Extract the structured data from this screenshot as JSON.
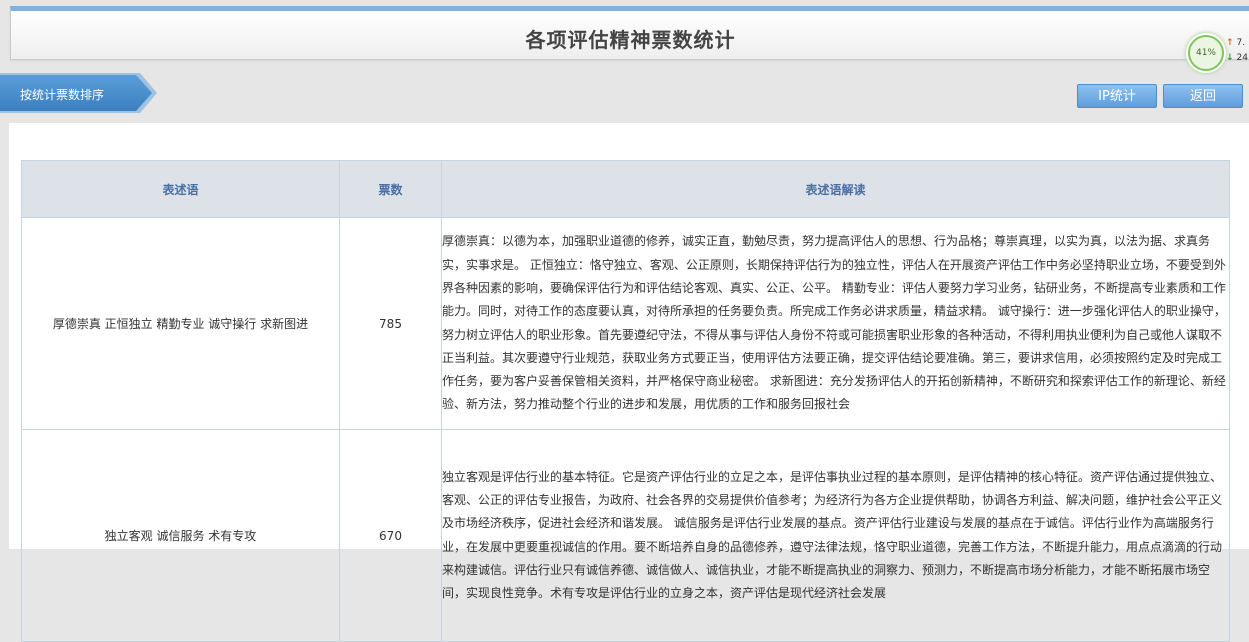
{
  "header": {
    "title": "各项评估精神票数统计"
  },
  "gauge": {
    "percent": "41%",
    "up_value": "7.",
    "down_value": "24"
  },
  "toolbar": {
    "sort_tab_label": "按统计票数排序",
    "ip_stats_label": "IP统计",
    "back_label": "返回"
  },
  "table": {
    "columns": [
      "表述语",
      "票数",
      "表述语解读"
    ],
    "rows": [
      {
        "phrase": "厚德崇真 正恒独立 精勤专业 诚守操行 求新图进",
        "votes": "785",
        "interpretation": "厚德崇真：以德为本，加强职业道德的修养，诚实正直，勤勉尽责，努力提高评估人的思想、行为品格；尊崇真理，以实为真，以法为据、求真务实，实事求是。 正恒独立：恪守独立、客观、公正原则，长期保持评估行为的独立性，评估人在开展资产评估工作中务必坚持职业立场，不要受到外界各种因素的影响，要确保评估行为和评估结论客观、真实、公正、公平。 精勤专业：评估人要努力学习业务，钻研业务，不断提高专业素质和工作能力。同时，对待工作的态度要认真，对待所承担的任务要负责。所完成工作务必讲求质量，精益求精。 诚守操行：进一步强化评估人的职业操守，努力树立评估人的职业形象。首先要遵纪守法，不得从事与评估人身份不符或可能损害职业形象的各种活动，不得利用执业便利为自己或他人谋取不正当利益。其次要遵守行业规范，获取业务方式要正当，使用评估方法要正确，提交评估结论要准确。第三，要讲求信用，必须按照约定及时完成工作任务，要为客户妥善保管相关资料，并严格保守商业秘密。 求新图进：充分发扬评估人的开拓创新精神，不断研究和探索评估工作的新理论、新经验、新方法，努力推动整个行业的进步和发展，用优质的工作和服务回报社会"
      },
      {
        "phrase": "独立客观 诚信服务 术有专攻",
        "votes": "670",
        "interpretation": "独立客观是评估行业的基本特征。它是资产评估行业的立足之本，是评估事执业过程的基本原则，是评估精神的核心特征。资产评估通过提供独立、客观、公正的评估专业报告，为政府、社会各界的交易提供价值参考；为经济行为各方企业提供帮助，协调各方利益、解决问题，维护社会公平正义及市场经济秩序，促进社会经济和谐发展。 诚信服务是评估行业发展的基点。资产评估行业建设与发展的基点在于诚信。评估行业作为高端服务行业，在发展中更要重视诚信的作用。要不断培养自身的品德修养，遵守法律法规，恪守职业道德，完善工作方法，不断提升能力，用点点滴滴的行动来构建诚信。评估行业只有诚信养德、诚信做人、诚信执业，才能不断提高执业的洞察力、预测力，不断提高市场分析能力，才能不断拓展市场空间，实现良性竞争。术有专攻是评估行业的立身之本，资产评估是现代经济社会发展"
      }
    ]
  }
}
